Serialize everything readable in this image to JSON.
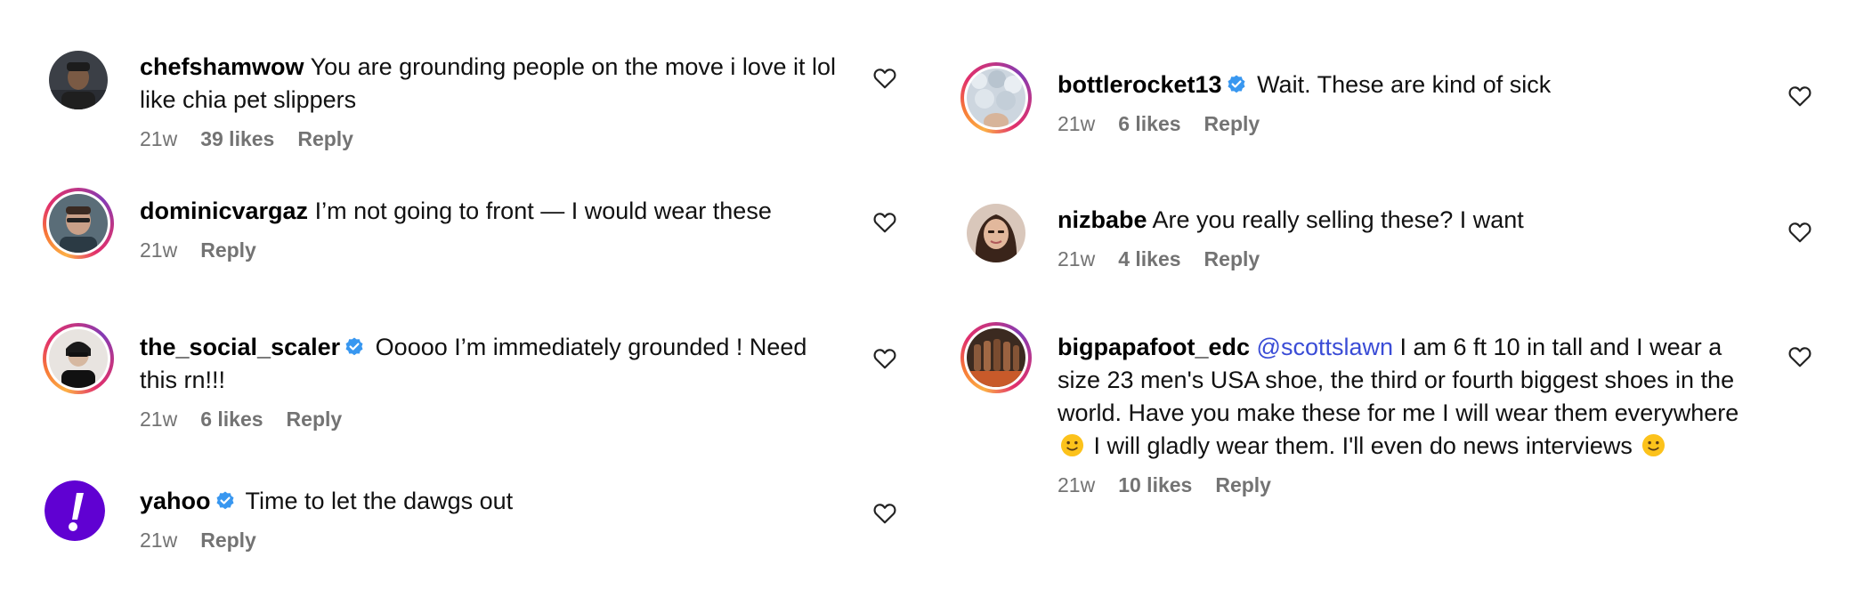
{
  "comments_left": [
    {
      "username": "chefshamwow",
      "verified": false,
      "text": "You are grounding people on the move i love it lol like chia pet slippers",
      "time": "21w",
      "likes": "39 likes",
      "reply": "Reply"
    },
    {
      "username": "dominicvargaz",
      "verified": false,
      "text": "I’m not going to front — I would wear these",
      "time": "21w",
      "likes": "",
      "reply": "Reply"
    },
    {
      "username": "the_social_scaler",
      "verified": true,
      "text": "Ooooo I’m immediately grounded ! Need this rn!!!",
      "time": "21w",
      "likes": "6 likes",
      "reply": "Reply"
    },
    {
      "username": "yahoo",
      "verified": true,
      "text": "Time to let the dawgs out",
      "time": "21w",
      "likes": "",
      "reply": "Reply"
    }
  ],
  "comments_right": [
    {
      "username": "bottlerocket13",
      "verified": true,
      "text": "Wait. These are kind of sick",
      "time": "21w",
      "likes": "6 likes",
      "reply": "Reply"
    },
    {
      "username": "nizbabe",
      "verified": false,
      "text": "Are you really selling these? I want",
      "time": "21w",
      "likes": "4 likes",
      "reply": "Reply"
    },
    {
      "username": "bigpapafoot_edc",
      "verified": false,
      "mention": "@scottslawn",
      "text_part1": "I am 6 ft 10 in tall and I wear a size 23 men's USA shoe, the third or fourth biggest shoes in the world. Have you make these for me I will wear them everywhere",
      "text_part2": "I will gladly wear them. I'll even do news interviews",
      "time": "21w",
      "likes": "10 likes",
      "reply": "Reply"
    }
  ],
  "icons": {
    "like": "heart-outline-icon",
    "verified": "verified-badge-icon",
    "emoji": "slightly-smiling-face-emoji"
  },
  "colors": {
    "meta_text": "#737373",
    "mention": "#3a4cd6",
    "verified_blue": "#3897f0",
    "yahoo_purple": "#6001d2"
  }
}
